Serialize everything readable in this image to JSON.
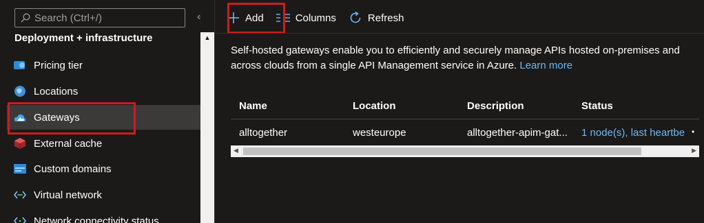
{
  "search": {
    "placeholder": "Search (Ctrl+/)"
  },
  "collapse_label": "«",
  "sidebar": {
    "section_title": "Deployment + infrastructure",
    "items": [
      {
        "label": "Pricing tier",
        "icon": "pricing-tier-icon"
      },
      {
        "label": "Locations",
        "icon": "globe-icon"
      },
      {
        "label": "Gateways",
        "icon": "cloud-gateway-icon",
        "selected": true
      },
      {
        "label": "External cache",
        "icon": "cache-cube-icon"
      },
      {
        "label": "Custom domains",
        "icon": "domain-icon"
      },
      {
        "label": "Virtual network",
        "icon": "virtual-network-icon"
      },
      {
        "label": "Network connectivity status",
        "icon": "network-status-icon"
      }
    ]
  },
  "toolbar": {
    "add_label": "Add",
    "columns_label": "Columns",
    "refresh_label": "Refresh"
  },
  "description": {
    "text": "Self-hosted gateways enable you to efficiently and securely manage APIs hosted on-premises and across clouds from a single API Management service in Azure.",
    "link": "Learn more"
  },
  "table": {
    "headers": [
      "Name",
      "Location",
      "Description",
      "Status"
    ],
    "rows": [
      [
        "alltogether",
        "westeurope",
        "alltogether-apim-gat...",
        "1 node(s), last heartbe"
      ]
    ]
  },
  "colors": {
    "accent": "#6cb8f6",
    "highlight": "#d01b1b",
    "background": "#1b1a19"
  }
}
